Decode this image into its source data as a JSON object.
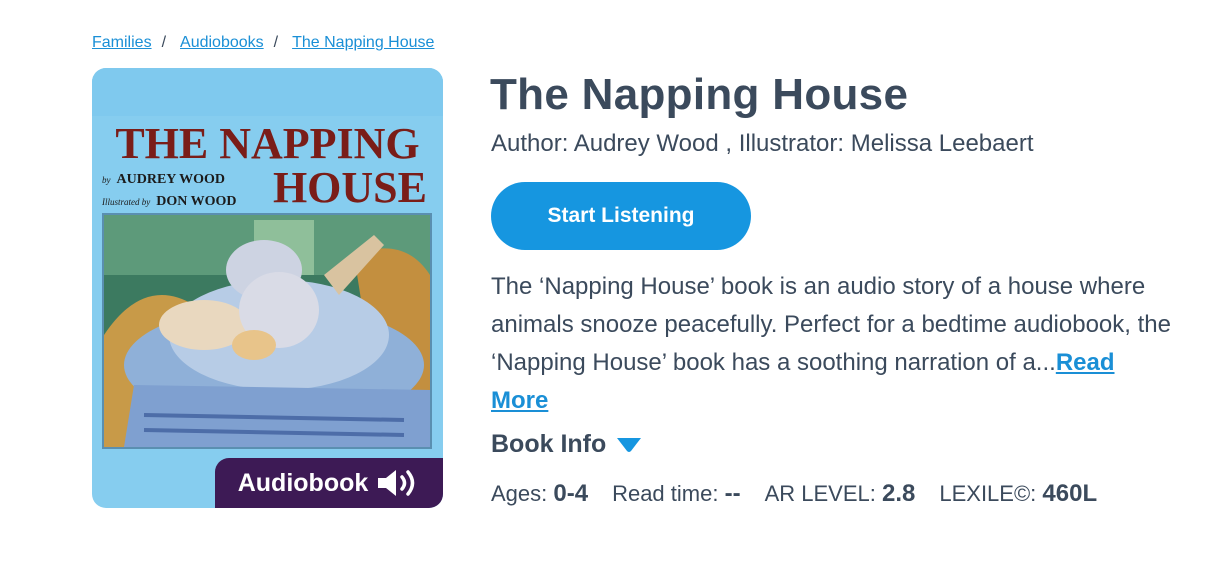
{
  "breadcrumb": {
    "items": [
      "Families",
      "Audiobooks",
      "The Napping House"
    ],
    "separator": "/"
  },
  "cover": {
    "title_line1": "THE NAPPING",
    "title_line2": "HOUSE",
    "by_prefix": "by",
    "author_name": "AUDREY WOOD",
    "illustrated_prefix": "Illustrated by",
    "illustrator_name": "DON WOOD",
    "badge_label": "Audiobook",
    "badge_icon": "speaker-icon",
    "colors": {
      "background": "#86cdef",
      "title": "#7a1d18",
      "badge": "#3d1a55"
    }
  },
  "book": {
    "title": "The Napping House",
    "credits": "Author: Audrey Wood , Illustrator: Melissa Leebaert",
    "description": "The ‘Napping House’ book is an audio story of a house where animals snooze peacefully. Perfect for a bedtime audiobook, the ‘Napping House’ book has a soothing narration of a...",
    "read_more": "Read More"
  },
  "actions": {
    "start_listening": "Start Listening"
  },
  "book_info": {
    "label": "Book Info",
    "icon": "caret-down-icon"
  },
  "stats": [
    {
      "label": "Ages:",
      "value": "0-4"
    },
    {
      "label": "Read time:",
      "value": "--"
    },
    {
      "label": "AR LEVEL:",
      "value": "2.8"
    },
    {
      "label": "LEXILE©:",
      "value": "460L"
    }
  ],
  "colors": {
    "accent": "#1696e0",
    "link": "#1a8fd6",
    "text": "#3b4a5c"
  }
}
